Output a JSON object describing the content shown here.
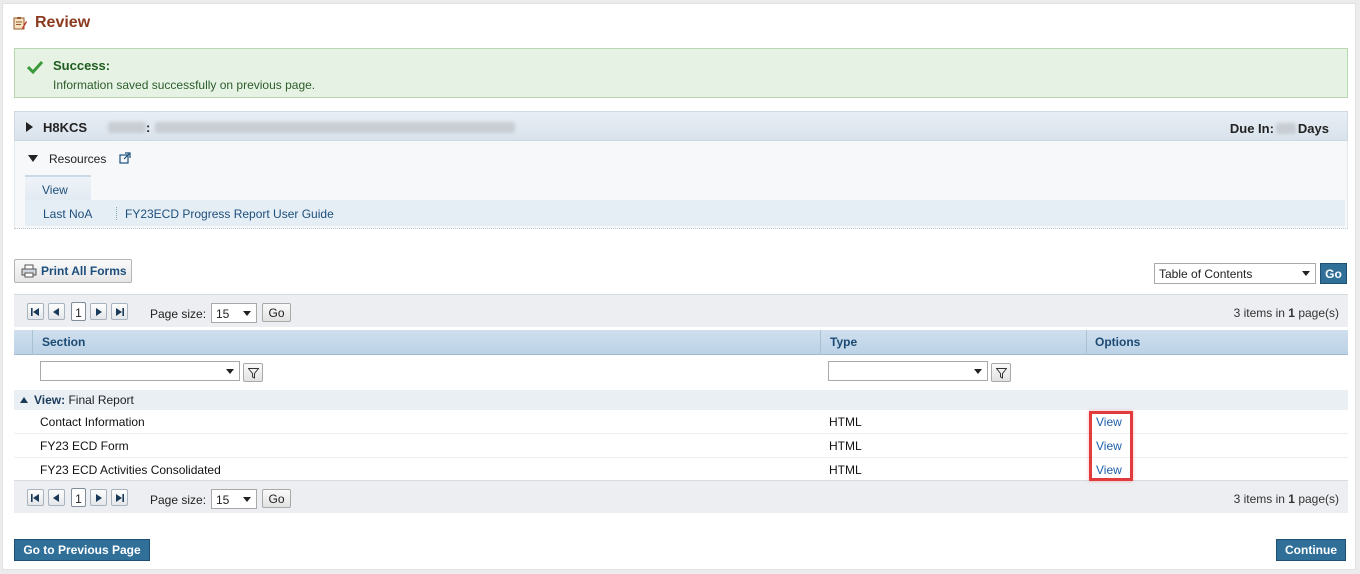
{
  "header": {
    "title": "Review",
    "icon": "clipboard-edit-icon"
  },
  "success": {
    "title": "Success:",
    "message": "Information saved successfully on previous page.",
    "icon": "checkmark-icon"
  },
  "grant": {
    "id_prefix": "H8KCS",
    "colon": ":",
    "due_label": "Due In:",
    "due_suffix": "Days"
  },
  "resources": {
    "label": "Resources",
    "tab_label": "View",
    "links": [
      "Last NoA",
      "FY23ECD Progress Report User Guide"
    ]
  },
  "toolbar": {
    "print_label": "Print All Forms",
    "toc_value": "Table of Contents",
    "go_label": "Go"
  },
  "pager": {
    "current_page": "1",
    "page_size_label": "Page size:",
    "page_size_value": "15",
    "go_label": "Go",
    "count": "3",
    "items_in": "items in",
    "page_count": "1",
    "pages_suffix": "page(s)"
  },
  "grid": {
    "columns": [
      "Section",
      "Type",
      "Options"
    ],
    "group_prefix": "View:",
    "group_name": "Final Report",
    "rows": [
      {
        "section": "Contact Information",
        "type": "HTML",
        "option": "View"
      },
      {
        "section": "FY23 ECD Form",
        "type": "HTML",
        "option": "View"
      },
      {
        "section": "FY23 ECD Activities Consolidated",
        "type": "HTML",
        "option": "View"
      }
    ]
  },
  "footer": {
    "previous_label": "Go to Previous Page",
    "continue_label": "Continue"
  },
  "colors": {
    "title": "#8b3a1f",
    "link": "#1d5fa8",
    "primary_button": "#2f6f98",
    "highlight": "#e23b3b"
  }
}
